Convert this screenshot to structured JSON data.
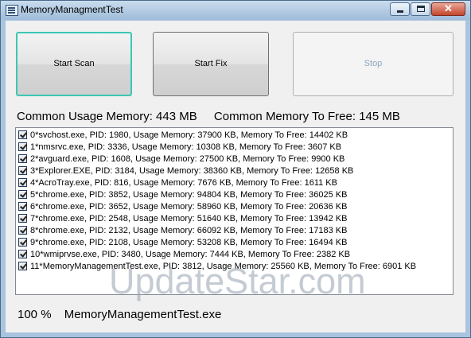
{
  "window": {
    "title": "MemoryManagmentTest",
    "close_label": "✕"
  },
  "buttons": {
    "start_scan": "Start Scan",
    "start_fix": "Start Fix",
    "stop": "Stop"
  },
  "summary": {
    "usage_label": "Common Usage Memory: 443 MB",
    "free_label": "Common Memory To Free: 145 MB"
  },
  "processes": [
    "0*svchost.exe, PID: 1980, Usage Memory: 37900 KB, Memory To Free: 14402 KB",
    "1*nmsrvc.exe, PID: 3336, Usage Memory: 10308 KB, Memory To Free: 3607 KB",
    "2*avguard.exe, PID: 1608, Usage Memory: 27500 KB, Memory To Free: 9900 KB",
    "3*Explorer.EXE, PID: 3184, Usage Memory: 38360 KB, Memory To Free: 12658 KB",
    "4*AcroTray.exe, PID: 816, Usage Memory: 7676 KB, Memory To Free: 1611 KB",
    "5*chrome.exe, PID: 3852, Usage Memory: 94804 KB, Memory To Free: 36025 KB",
    "6*chrome.exe, PID: 3652, Usage Memory: 58960 KB, Memory To Free: 20636 KB",
    "7*chrome.exe, PID: 2548, Usage Memory: 51640 KB, Memory To Free: 13942 KB",
    "8*chrome.exe, PID: 2132, Usage Memory: 66092 KB, Memory To Free: 17183 KB",
    "9*chrome.exe, PID: 2108, Usage Memory: 53208 KB, Memory To Free: 16494 KB",
    "10*wmiprvse.exe, PID: 3480, Usage Memory: 7444 KB, Memory To Free: 2382 KB",
    "11*MemoryManagementTest.exe, PID: 3812, Usage Memory: 25560 KB, Memory To Free: 6901 KB"
  ],
  "status": {
    "percent": "100 %",
    "process": "MemoryManagementTest.exe"
  },
  "watermark": "UpdateStar.com"
}
